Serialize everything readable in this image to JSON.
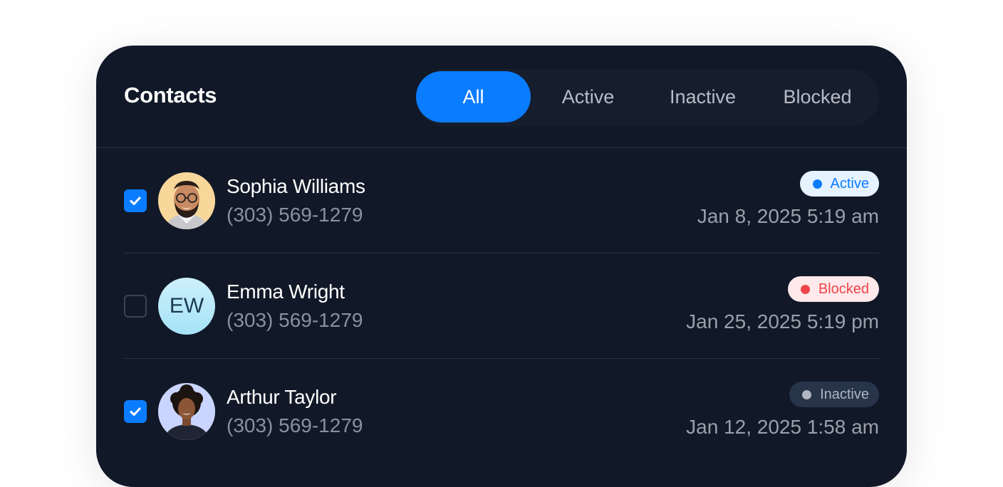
{
  "header": {
    "title": "Contacts",
    "tabs": [
      {
        "label": "All",
        "selected": true
      },
      {
        "label": "Active",
        "selected": false
      },
      {
        "label": "Inactive",
        "selected": false
      },
      {
        "label": "Blocked",
        "selected": false
      }
    ]
  },
  "contacts": [
    {
      "name": "Sophia Williams",
      "phone": "(303) 569-1279",
      "checked": true,
      "avatar": "photo-man-glasses",
      "status": "Active",
      "datetime": "Jan 8, 2025 5:19 am"
    },
    {
      "name": "Emma Wright",
      "phone": "(303) 569-1279",
      "checked": false,
      "avatar_initials": "EW",
      "status": "Blocked",
      "datetime": "Jan 25, 2025 5:19 pm"
    },
    {
      "name": "Arthur Taylor",
      "phone": "(303) 569-1279",
      "checked": true,
      "avatar": "photo-woman-curly-hair",
      "status": "Inactive",
      "datetime": "Jan 12, 2025 1:58 am"
    }
  ],
  "colors": {
    "accent": "#0a7cff",
    "card_bg": "#111827",
    "active": "#0a7cff",
    "blocked": "#f0444a",
    "inactive": "#b0b6bf"
  },
  "icons": {
    "checkbox_checked": "checkmark-icon"
  }
}
